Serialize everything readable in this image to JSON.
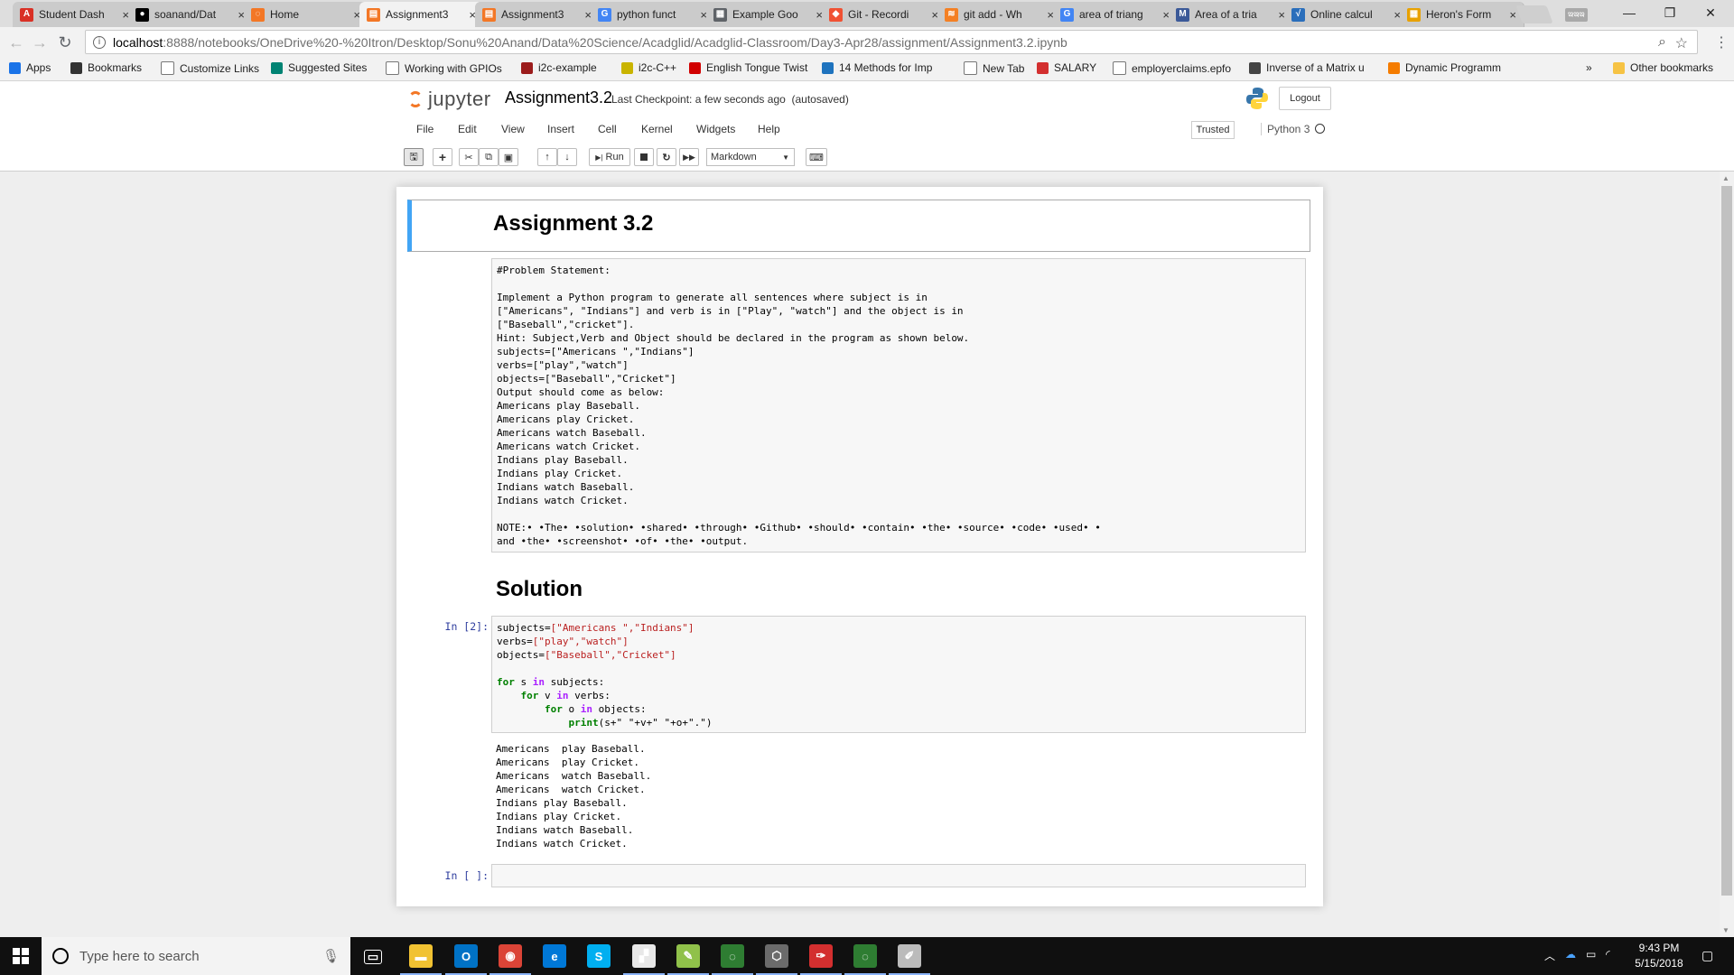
{
  "tabs": [
    {
      "title": "Student Dash",
      "icon": "acadgild-icon",
      "color": "#d93025",
      "glyph": "A"
    },
    {
      "title": "soanand/Dat",
      "icon": "github-icon",
      "color": "#000000",
      "glyph": "●"
    },
    {
      "title": "Home",
      "icon": "jupyter-icon",
      "color": "#f37726",
      "glyph": "◌"
    },
    {
      "title": "Assignment3",
      "icon": "jupyter-notebook-icon",
      "color": "#f37726",
      "glyph": "▤"
    },
    {
      "title": "Assignment3",
      "icon": "jupyter-notebook-icon",
      "color": "#f37726",
      "glyph": "▤"
    },
    {
      "title": "python funct",
      "icon": "google-icon",
      "color": "#4285f4",
      "glyph": "G"
    },
    {
      "title": "Example Goo",
      "icon": "document-icon",
      "color": "#5f6368",
      "glyph": "▦"
    },
    {
      "title": "Git - Recordi",
      "icon": "git-icon",
      "color": "#f05133",
      "glyph": "◆"
    },
    {
      "title": "git add - Wh",
      "icon": "stackoverflow-icon",
      "color": "#f48024",
      "glyph": "≋"
    },
    {
      "title": "area of triang",
      "icon": "google-icon",
      "color": "#4285f4",
      "glyph": "G"
    },
    {
      "title": "Area of a tria",
      "icon": "math-icon",
      "color": "#3b5998",
      "glyph": "M"
    },
    {
      "title": "Online calcul",
      "icon": "calculator-icon",
      "color": "#2a6ebb",
      "glyph": "√"
    },
    {
      "title": "Heron's Form",
      "icon": "grid-icon",
      "color": "#e8a100",
      "glyph": "▦"
    }
  ],
  "browser": {
    "profile": "ఇఇఇ",
    "minimize": "—",
    "restore": "❐",
    "close": "✕",
    "url_host": "localhost",
    "url_path": ":8888/notebooks/OneDrive%20-%20Itron/Desktop/Sonu%20Anand/Data%20Science/Acadglid/Acadglid-Classroom/Day3-Apr28/assignment/Assignment3.2.ipynb"
  },
  "bookmarks": [
    {
      "label": "Apps",
      "icon": "apps-icon",
      "color": "#1a73e8"
    },
    {
      "label": "Bookmarks",
      "icon": "star-icon",
      "color": "#333333"
    },
    {
      "label": "Customize Links",
      "icon": "page-icon",
      "color": "#ffffff"
    },
    {
      "label": "Suggested Sites",
      "icon": "bing-icon",
      "color": "#008373"
    },
    {
      "label": "Working with GPIOs",
      "icon": "page-icon",
      "color": "#ffffff"
    },
    {
      "label": "i2c-example",
      "icon": "bug-icon",
      "color": "#9b1c1c"
    },
    {
      "label": "i2c-C++",
      "icon": "bulb-icon",
      "color": "#c9b400"
    },
    {
      "label": "English Tongue Twist",
      "icon": "flag-icon",
      "color": "#d10000"
    },
    {
      "label": "14 Methods for Imp",
      "icon": "handshake-icon",
      "color": "#1e73be"
    },
    {
      "label": "New Tab",
      "icon": "page-icon",
      "color": "#ffffff"
    },
    {
      "label": "SALARY",
      "icon": "salary-icon",
      "color": "#d32f2f"
    },
    {
      "label": "employerclaims.epfo",
      "icon": "page-icon",
      "color": "#ffffff"
    },
    {
      "label": "Inverse of a Matrix u",
      "icon": "matrix-icon",
      "color": "#444444"
    },
    {
      "label": "Dynamic Programm",
      "icon": "paw-icon",
      "color": "#f57c00"
    }
  ],
  "bookmarks_more": "»",
  "other_bookmarks": "Other bookmarks",
  "jupyter": {
    "logo_text": "jupyter",
    "notebook_name": "Assignment3.2",
    "checkpoint": "Last Checkpoint: a few seconds ago",
    "autosave": "(autosaved)",
    "logout": "Logout",
    "menus": [
      "File",
      "Edit",
      "View",
      "Insert",
      "Cell",
      "Kernel",
      "Widgets",
      "Help"
    ],
    "trusted": "Trusted",
    "kernel": "Python 3",
    "run_label": "Run",
    "cell_type": "Markdown"
  },
  "notebook": {
    "heading": "Assignment 3.2",
    "problem_lines": [
      "#Problem Statement:",
      "",
      "Implement a Python program to generate all sentences where subject is in",
      "[\"Americans\", \"Indians\"] and verb is in [\"Play\", \"watch\"] and the object is in",
      "[\"Baseball\",\"cricket\"].",
      "Hint: Subject,Verb and Object should be declared in the program as shown below.",
      "subjects=[\"Americans \",\"Indians\"]",
      "verbs=[\"play\",\"watch\"]",
      "objects=[\"Baseball\",\"Cricket\"]",
      "Output should come as below:",
      "Americans play Baseball.",
      "Americans play Cricket.",
      "Americans watch Baseball.",
      "Americans watch Cricket.",
      "Indians play Baseball.",
      "Indians play Cricket.",
      "Indians watch Baseball.",
      "Indians watch Cricket.",
      "",
      "NOTE:• •The• •solution• •shared• •through• •Github• •should• •contain• •the• •source• •code• •used• •",
      "and •the• •screenshot• •of• •the• •output."
    ],
    "solution_heading": "Solution",
    "code_prompt": "In [2]:",
    "code": {
      "subjects_var": "subjects=",
      "subjects_val": "[\"Americans \",\"Indians\"]",
      "verbs_var": "verbs=",
      "verbs_val": "[\"play\",\"watch\"]",
      "objects_var": "objects=",
      "objects_val": "[\"Baseball\",\"Cricket\"]",
      "loop1_kw": "for",
      "loop1_rest": " s ",
      "loop1_in": "in",
      "loop1_end": " subjects:",
      "loop2_kw": "for",
      "loop2_rest": " v ",
      "loop2_in": "in",
      "loop2_end": " verbs:",
      "loop3_kw": "for",
      "loop3_rest": " o ",
      "loop3_in": "in",
      "loop3_end": " objects:",
      "print_kw": "print",
      "print_args": "(s+\" \"+v+\" \"+o+\".\")"
    },
    "output_lines": [
      "Americans  play Baseball.",
      "Americans  play Cricket.",
      "Americans  watch Baseball.",
      "Americans  watch Cricket.",
      "Indians play Baseball.",
      "Indians play Cricket.",
      "Indians watch Baseball.",
      "Indians watch Cricket."
    ],
    "empty_prompt": "In [ ]:"
  },
  "taskbar": {
    "search_placeholder": "Type here to search",
    "time": "9:43 PM",
    "date": "5/15/2018",
    "apps": [
      {
        "icon": "task-view-icon",
        "color": "#101010",
        "glyph": "▭"
      },
      {
        "icon": "file-explorer-icon",
        "color": "#f1c232",
        "glyph": "▬"
      },
      {
        "icon": "outlook-icon",
        "color": "#0072c6",
        "glyph": "O"
      },
      {
        "icon": "chrome-icon",
        "color": "#db4437",
        "glyph": "◉"
      },
      {
        "icon": "edge-icon",
        "color": "#0078d7",
        "glyph": "e"
      },
      {
        "icon": "skype-icon",
        "color": "#00aff0",
        "glyph": "S"
      },
      {
        "icon": "notepad-icon",
        "color": "#e8e8e8",
        "glyph": "▞"
      },
      {
        "icon": "notepadpp-icon",
        "color": "#90c14a",
        "glyph": "✎"
      },
      {
        "icon": "refresh-app-icon",
        "color": "#2e7d32",
        "glyph": "◌"
      },
      {
        "icon": "virtualbox-icon",
        "color": "#6b6b6b",
        "glyph": "⬡"
      },
      {
        "icon": "pdf-icon",
        "color": "#d32f2f",
        "glyph": "✑"
      },
      {
        "icon": "sync-app-icon",
        "color": "#2e7d32",
        "glyph": "◌"
      },
      {
        "icon": "paint-icon",
        "color": "#bbbbbb",
        "glyph": "✐"
      }
    ]
  }
}
